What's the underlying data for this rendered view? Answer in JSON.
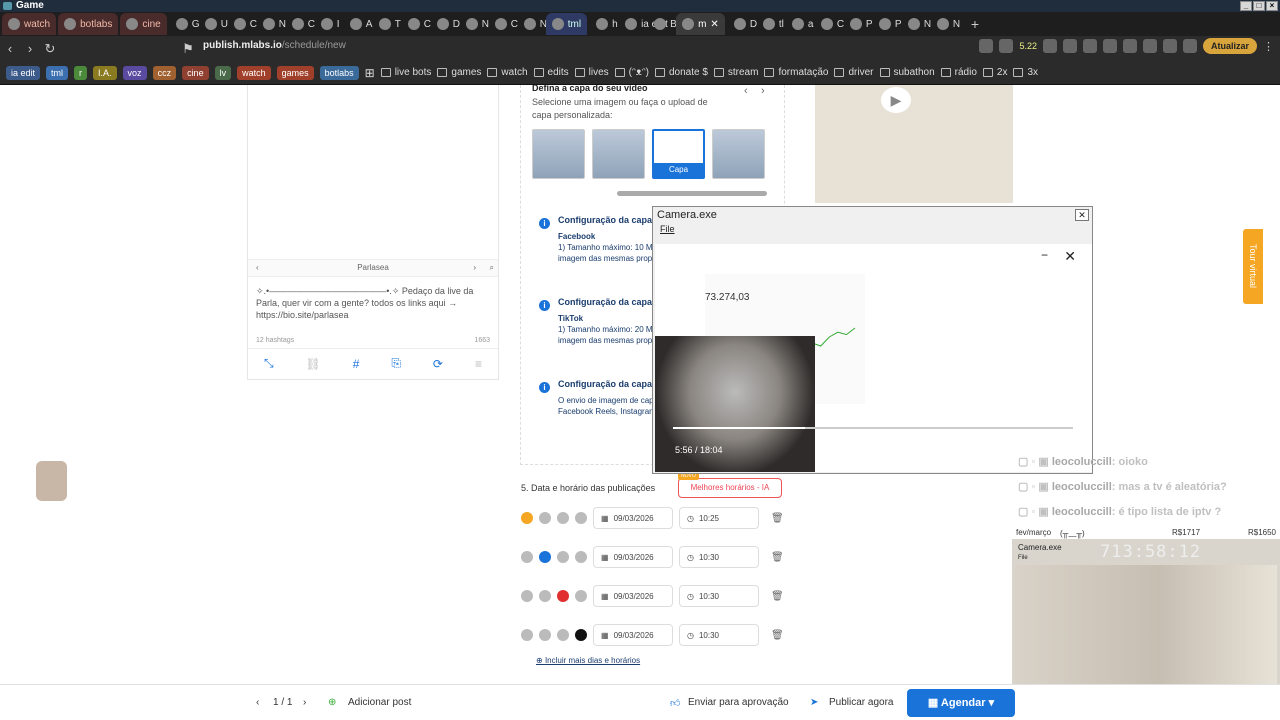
{
  "window": {
    "title": "Game"
  },
  "tabs": [
    {
      "label": "watch",
      "kind": "named"
    },
    {
      "label": "botlabs",
      "kind": "named"
    },
    {
      "label": "cine",
      "kind": "named"
    },
    {
      "label": "G",
      "kind": "small"
    },
    {
      "label": "U",
      "kind": "small"
    },
    {
      "label": "C",
      "kind": "small"
    },
    {
      "label": "N",
      "kind": "small"
    },
    {
      "label": "C",
      "kind": "small"
    },
    {
      "label": "I",
      "kind": "small"
    },
    {
      "label": "A",
      "kind": "small"
    },
    {
      "label": "T",
      "kind": "small"
    },
    {
      "label": "C",
      "kind": "small"
    },
    {
      "label": "D",
      "kind": "small"
    },
    {
      "label": "N",
      "kind": "small"
    },
    {
      "label": "C",
      "kind": "small"
    },
    {
      "label": "N",
      "kind": "small"
    },
    {
      "label": "tml",
      "kind": "tml"
    },
    {
      "label": "h",
      "kind": "small"
    },
    {
      "label": "ia edit",
      "kind": "small"
    },
    {
      "label": "B",
      "kind": "small"
    },
    {
      "label": "m",
      "kind": "active"
    },
    {
      "label": "D",
      "kind": "small"
    },
    {
      "label": "tl",
      "kind": "small"
    },
    {
      "label": "a",
      "kind": "small"
    },
    {
      "label": "C",
      "kind": "small"
    },
    {
      "label": "P",
      "kind": "small"
    },
    {
      "label": "P",
      "kind": "small"
    },
    {
      "label": "N",
      "kind": "small"
    },
    {
      "label": "N",
      "kind": "small"
    }
  ],
  "address": {
    "url_host": "publish.mlabs.io",
    "url_path": "/schedule/new",
    "badge": "5.22",
    "update_label": "Atualizar"
  },
  "bookmarks": {
    "chips": [
      {
        "label": "ia edit",
        "color": "#3c5a8a"
      },
      {
        "label": "tml",
        "color": "#3b6fb0"
      },
      {
        "label": "r",
        "color": "#4a8a3a"
      },
      {
        "label": "I.A.",
        "color": "#8a7a20"
      },
      {
        "label": "voz",
        "color": "#5a4aa0"
      },
      {
        "label": "ccz",
        "color": "#a06030"
      },
      {
        "label": "cine",
        "color": "#904030"
      },
      {
        "label": "lv",
        "color": "#4a6a4a"
      },
      {
        "label": "watch",
        "color": "#a0402a"
      },
      {
        "label": "games",
        "color": "#a0402a"
      },
      {
        "label": "botlabs",
        "color": "#3a6a9a"
      }
    ],
    "folders": [
      "live bots",
      "games",
      "watch",
      "edits",
      "lives",
      "(ᵔᴥᵔ)",
      "donate $",
      "stream",
      "formatação",
      "driver",
      "subathon",
      "rádio",
      "2x",
      "3x"
    ]
  },
  "cover": {
    "title": "Defina a capa do seu vídeo",
    "desc": "Selecione uma imagem ou faça o upload de capa personalizada:",
    "cover_label": "Capa"
  },
  "info": [
    {
      "title": "Configuração da capa",
      "platform": "Facebook",
      "body": "1) Tamanho máximo: 10 MB; image/jpeg, image/png; uma imagem das mesmas proporções"
    },
    {
      "title": "Configuração da capa",
      "platform": "TikTok",
      "body": "1) Tamanho máximo: 20 MB; image/jpeg, image/png; uma imagem das mesmas proporções"
    },
    {
      "title": "Configuração da capa",
      "platform": "",
      "body": "O envio de imagem de capa está habilitado para YouTube, Facebook Reels, Instagram Reels"
    }
  ],
  "preview": {
    "account": "Parlasea",
    "text": "✧.•—————————————•.✧ Pedaço da live da Parla, quer vir com a gente? todos os links aqui → https://bio.site/parlasea",
    "hashtags": "12 hashtags",
    "chars": "1663"
  },
  "schedule": {
    "section_title": "5. Data e horário das publicações",
    "best_times": "Melhores horários - IA",
    "new_badge": "NOVO",
    "rows": [
      {
        "date": "09/03/2026",
        "time": "10:25",
        "active_color": "#f5a623"
      },
      {
        "date": "09/03/2026",
        "time": "10:30",
        "active_color": "#1a73d9"
      },
      {
        "date": "09/03/2026",
        "time": "10:30",
        "active_color": "#e03030"
      },
      {
        "date": "09/03/2026",
        "time": "10:30",
        "active_color": "#111111"
      }
    ],
    "more_link": "Incluir mais dias e horários"
  },
  "tour": {
    "label": "Tour virtual"
  },
  "camera": {
    "title": "Camera.exe",
    "menu_file": "File",
    "video_time": "5:56 / 18:04",
    "video_progress": 0.33,
    "chart_value": "73.274,03",
    "chart_values": [
      0.2,
      0.25,
      0.22,
      0.3,
      0.35,
      0.33,
      0.42,
      0.5,
      0.47,
      0.6,
      0.55,
      0.7,
      0.78,
      0.74,
      0.85
    ]
  },
  "chat": [
    {
      "user": "leocoluccill",
      "msg": ": oioko"
    },
    {
      "user": "leocoluccill",
      "msg": ": mas a tv é aleatória?"
    },
    {
      "user": "leocoluccill",
      "msg": ": é tipo lista de iptv ?"
    }
  ],
  "overlay": {
    "header_left": "fev/março",
    "header_faces": "(╥﹏╥)",
    "header_r1": "R$1717",
    "header_r2": "R$1650",
    "title": "Camera.exe",
    "file": "File",
    "timer": "713:58:12"
  },
  "bottom": {
    "page": "1 / 1",
    "add_post": "Adicionar post",
    "send_approval": "Enviar para aprovação",
    "publish_now": "Publicar agora",
    "schedule": "Agendar"
  }
}
